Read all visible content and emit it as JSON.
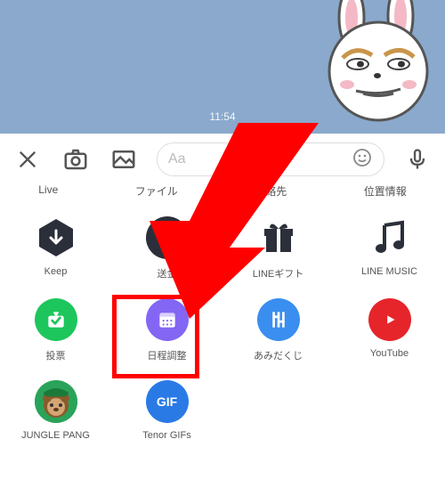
{
  "chat": {
    "time": "11:54"
  },
  "input": {
    "placeholder": "Aa"
  },
  "top_labels": [
    "Live",
    "ファイル",
    "連絡先",
    "位置情報"
  ],
  "grid": {
    "items": [
      {
        "label": "Keep",
        "key": "keep"
      },
      {
        "label": "送金",
        "key": "transfer"
      },
      {
        "label": "LINEギフト",
        "key": "gift"
      },
      {
        "label": "LINE MUSIC",
        "key": "music"
      },
      {
        "label": "投票",
        "key": "vote"
      },
      {
        "label": "日程調整",
        "key": "schedule"
      },
      {
        "label": "あみだくじ",
        "key": "amida"
      },
      {
        "label": "YouTube",
        "key": "youtube"
      },
      {
        "label": "JUNGLE PANG",
        "key": "jungle"
      },
      {
        "label": "Tenor GIFs",
        "key": "tenor"
      }
    ]
  },
  "colors": {
    "keep": "#2b2f3a",
    "transfer": "#2b2f3a",
    "gift": "#2b2f3a",
    "music": "#2b2f3a",
    "vote": "#1dc65c",
    "schedule": "#8466f5",
    "amida": "#3a8ef0",
    "youtube": "#e6252a",
    "jungle": "#2aa35a",
    "tenor": "#2a7ae6",
    "highlight": "#f00"
  },
  "icons": {
    "gif_text": "GIF"
  }
}
